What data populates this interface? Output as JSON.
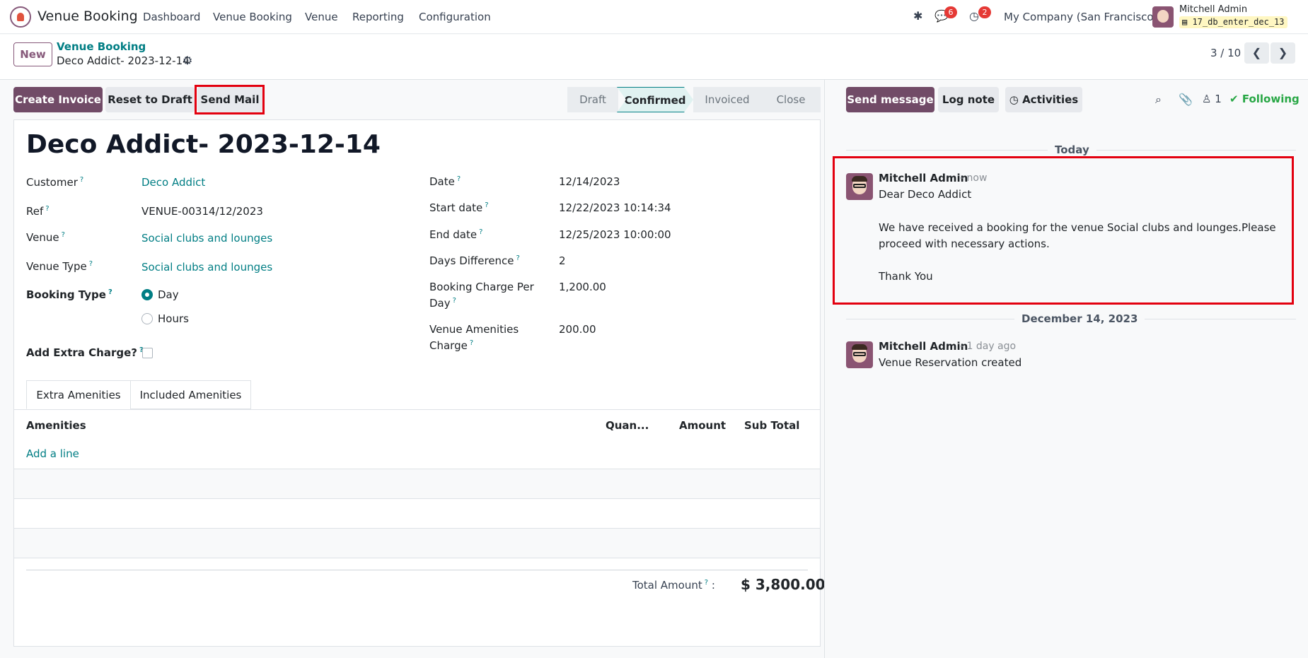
{
  "navbar": {
    "app_name": "Venue Booking",
    "menus": [
      "Dashboard",
      "Venue Booking",
      "Venue",
      "Reporting",
      "Configuration"
    ],
    "messages_count": "6",
    "activities_count": "2",
    "company": "My Company (San Francisco)",
    "user_name": "Mitchell Admin",
    "database": "17_db_enter_dec_13"
  },
  "control": {
    "new_label": "New",
    "breadcrumb_parent": "Venue Booking",
    "breadcrumb_current": "Deco Addict- 2023-12-14",
    "pager": "3 / 10",
    "pager_prev": "❮",
    "pager_next": "❯"
  },
  "actions": {
    "create_invoice": "Create Invoice",
    "reset_to_draft": "Reset to Draft",
    "send_mail": "Send Mail"
  },
  "statusbar": {
    "stages": [
      "Draft",
      "Confirmed",
      "Invoiced",
      "Close"
    ],
    "active": "Confirmed"
  },
  "form": {
    "title": "Deco Addict- 2023-12-14",
    "left": {
      "customer_label": "Customer",
      "customer": "Deco Addict",
      "ref_label": "Ref",
      "ref": "VENUE-00314/12/2023",
      "venue_label": "Venue",
      "venue": "Social clubs and lounges",
      "venue_type_label": "Venue Type",
      "venue_type": "Social clubs and lounges",
      "booking_type_label": "Booking Type",
      "booking_type_options": [
        "Day",
        "Hours"
      ],
      "booking_type_selected": "Day",
      "extra_charge_label": "Add Extra Charge?",
      "extra_charge_checked": false
    },
    "right": {
      "date_label": "Date",
      "date": "12/14/2023",
      "start_label": "Start date",
      "start": "12/22/2023 10:14:34",
      "end_label": "End date",
      "end": "12/25/2023 10:00:00",
      "days_label": "Days Difference",
      "days": "2",
      "charge_label_1": "Booking Charge Per",
      "charge_label_2": "Day",
      "charge": "1,200.00",
      "amenities_label_1": "Venue Amenities",
      "amenities_label_2": "Charge",
      "amenities_charge": "200.00"
    },
    "tabs": [
      "Extra Amenities",
      "Included Amenities"
    ],
    "table_headers": [
      "Amenities",
      "Quan...",
      "Amount",
      "Sub Total"
    ],
    "add_line": "Add a line",
    "total_label": "Total Amount",
    "total_value": "$ 3,800.00"
  },
  "chatter": {
    "send_message": "Send message",
    "log_note": "Log note",
    "activities": "Activities",
    "followers_count": "1",
    "following": "Following",
    "sections": [
      {
        "day": "Today",
        "author": "Mitchell Admin",
        "time": "- now",
        "lines": [
          "Dear Deco Addict",
          "We have received a booking for the venue Social clubs and lounges.Please",
          "proceed with necessary actions.",
          "Thank You"
        ]
      },
      {
        "day": "December 14, 2023",
        "author": "Mitchell Admin",
        "time": "- 1 day ago",
        "lines": [
          "Venue Reservation created"
        ]
      }
    ]
  },
  "colors": {
    "brand": "#714b67",
    "link": "#017e84",
    "highlight": "#e3000f",
    "badge": "#e53935"
  }
}
